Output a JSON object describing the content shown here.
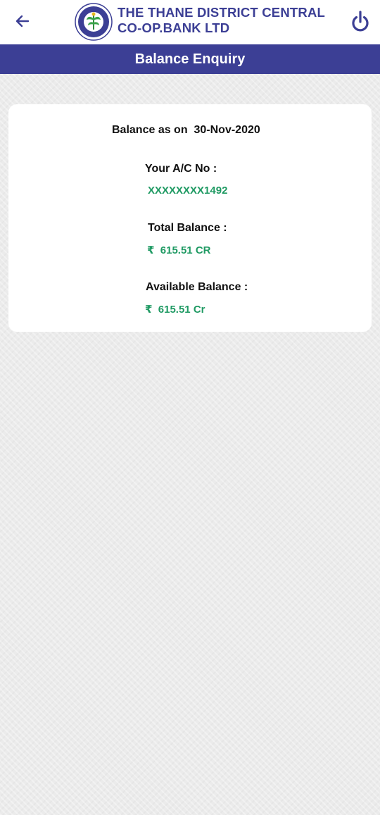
{
  "header": {
    "back_icon": "arrow-left-icon",
    "logo": "bank-emblem",
    "bank_name_line1": "THE THANE DISTRICT CENTRAL",
    "bank_name_line2": "CO-OP.BANK LTD",
    "power_icon": "power-icon",
    "brand_color": "#3c3f95"
  },
  "title_bar": {
    "title": "Balance Enquiry"
  },
  "balance": {
    "as_on_label": "Balance as on",
    "as_on_date": "30-Nov-2020",
    "account_label": "Your A/C No :",
    "account_number": "XXXXXXXX1492",
    "total_label": "Total Balance :",
    "total_value": "₹  615.51 CR",
    "available_label": "Available Balance :",
    "available_value": "₹  615.51 Cr",
    "value_color": "#1f9a63"
  }
}
